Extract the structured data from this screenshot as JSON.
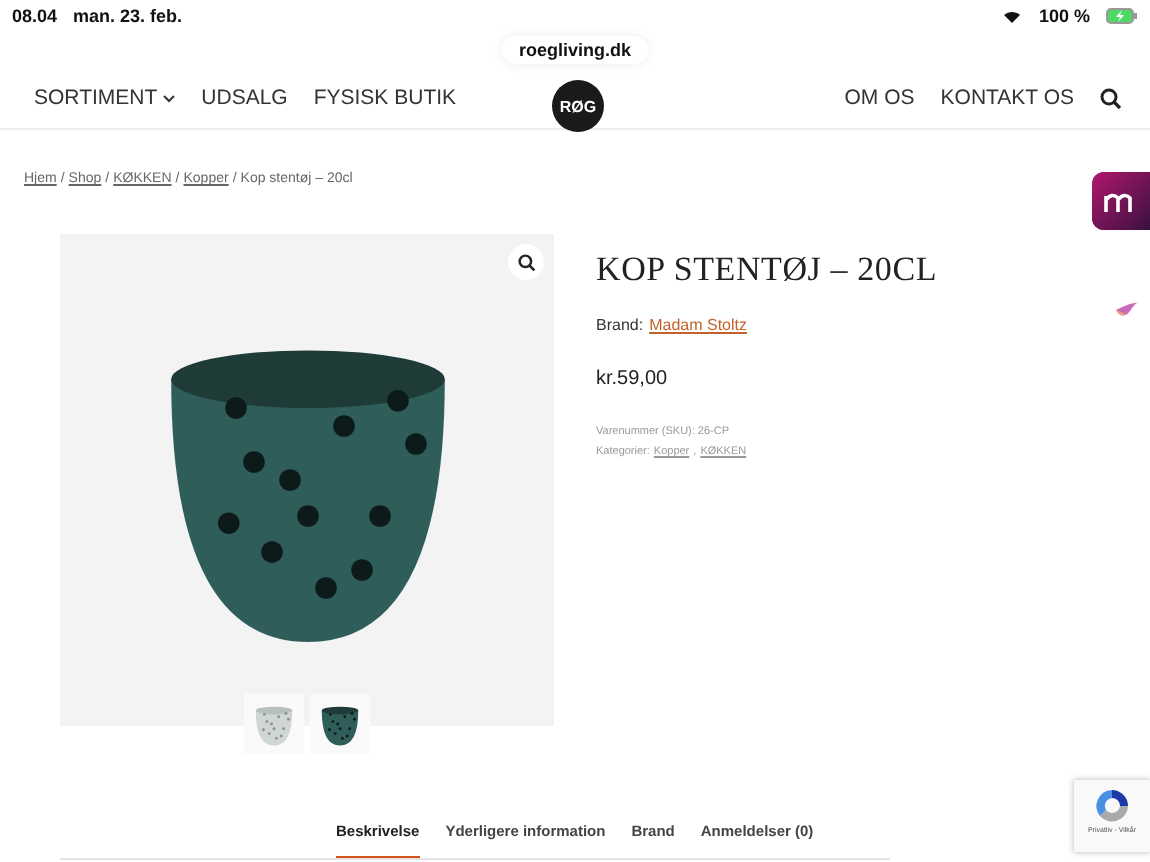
{
  "status_bar": {
    "time": "08.04",
    "date": "man. 23. feb.",
    "battery": "100 %"
  },
  "address": "roegliving.dk",
  "nav": {
    "left": [
      {
        "label": "SORTIMENT",
        "dropdown": true
      },
      {
        "label": "UDSALG",
        "dropdown": false
      },
      {
        "label": "FYSISK BUTIK",
        "dropdown": false
      }
    ],
    "logo": "RØG",
    "right": [
      "OM OS",
      "KONTAKT OS"
    ]
  },
  "breadcrumb": [
    {
      "kind": "link",
      "label": "Hjem"
    },
    {
      "kind": "separator",
      "label": "/"
    },
    {
      "kind": "link",
      "label": "Shop"
    },
    {
      "kind": "separator",
      "label": "/"
    },
    {
      "kind": "link",
      "label": "KØKKEN"
    },
    {
      "kind": "separator",
      "label": "/"
    },
    {
      "kind": "link",
      "label": "Kopper"
    },
    {
      "kind": "separator",
      "label": "/"
    },
    {
      "kind": "current",
      "label": "Kop stentøj – 20cl"
    }
  ],
  "product": {
    "title": "KOP STENTØJ – 20CL",
    "brand_label": "Brand:",
    "brand": "Madam Stoltz",
    "price": "kr.59,00",
    "sku": "Varenummer (SKU): 26-CP",
    "categories_label": "Kategorier:",
    "categories": [
      {
        "kind": "link",
        "label": "Kopper"
      },
      {
        "kind": "separator",
        "label": ","
      },
      {
        "kind": "link",
        "label": "KØKKEN"
      }
    ]
  },
  "thumbnails": [
    {
      "kind": "light"
    },
    {
      "kind": "dark"
    }
  ],
  "tabs": [
    {
      "label": "Beskrivelse",
      "selected": true
    },
    {
      "label": "Yderligere information",
      "selected": false
    },
    {
      "label": "Brand",
      "selected": false
    },
    {
      "label": "Anmeldelser (0)",
      "selected": false
    }
  ],
  "recaptcha": "Privatliv - Vilkår"
}
